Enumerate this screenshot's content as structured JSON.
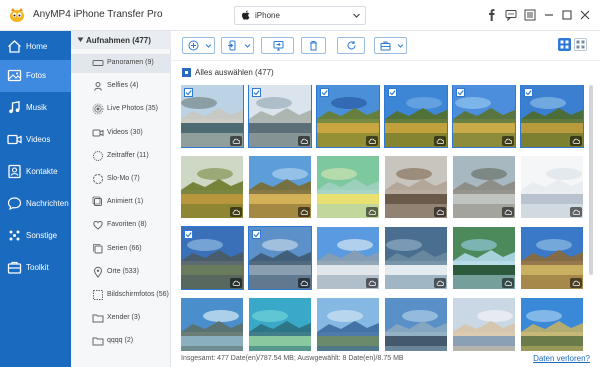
{
  "window": {
    "title": "AnyMP4 iPhone Transfer Pro",
    "device": "iPhone"
  },
  "titlebar_icons": [
    "facebook-icon",
    "feedback-icon",
    "menu-icon",
    "minimize-icon",
    "maximize-icon",
    "close-icon"
  ],
  "sidebar": {
    "items": [
      {
        "label": "Home",
        "icon": "home-icon"
      },
      {
        "label": "Fotos",
        "icon": "photos-icon",
        "active": true
      },
      {
        "label": "Musik",
        "icon": "music-icon"
      },
      {
        "label": "Videos",
        "icon": "video-icon"
      },
      {
        "label": "Kontakte",
        "icon": "contacts-icon"
      },
      {
        "label": "Nachrichten",
        "icon": "messages-icon"
      },
      {
        "label": "Sonstige",
        "icon": "others-icon"
      },
      {
        "label": "Toolkit",
        "icon": "toolkit-icon"
      }
    ]
  },
  "categories": {
    "header": "Aufnahmen (477)",
    "items": [
      {
        "label": "Panoramen (9)",
        "icon": "panorama-icon",
        "active": true
      },
      {
        "label": "Selfies (4)",
        "icon": "selfie-icon"
      },
      {
        "label": "Live Photos (35)",
        "icon": "live-photo-icon"
      },
      {
        "label": "Videos (30)",
        "icon": "video-icon"
      },
      {
        "label": "Zeitraffer (11)",
        "icon": "timelapse-icon"
      },
      {
        "label": "Slo-Mo (7)",
        "icon": "slomo-icon"
      },
      {
        "label": "Animiert (1)",
        "icon": "animated-icon"
      },
      {
        "label": "Favoriten (8)",
        "icon": "favorites-icon"
      },
      {
        "label": "Serien (66)",
        "icon": "burst-icon"
      },
      {
        "label": "Orte (533)",
        "icon": "places-icon"
      },
      {
        "label": "Bildschirmfotos (56)",
        "icon": "screenshot-icon"
      },
      {
        "label": "Xender (3)",
        "icon": "folder-icon"
      },
      {
        "label": "qqqq (2)",
        "icon": "folder-icon"
      }
    ]
  },
  "toolbar": {
    "buttons": [
      "add-button",
      "export-to-device-button",
      "export-to-pc-button",
      "delete-button",
      "refresh-button",
      "toolbox-button"
    ],
    "views": [
      "grid-view-button",
      "list-view-button"
    ]
  },
  "select_all": {
    "label": "Alles auswählen (477)",
    "checked": true
  },
  "photos": {
    "selected": [
      true,
      true,
      true,
      true,
      true,
      true,
      false,
      false,
      false,
      false,
      false,
      false,
      true,
      true,
      false,
      false,
      false,
      false,
      false,
      false,
      false,
      false,
      false,
      false
    ]
  },
  "status": {
    "text": "Insgesamt: 477 Date(en)/787.54 MB; Auswgewählt: 8 Date(en)/8.75 MB",
    "link": "Daten verloren?"
  },
  "colors": {
    "sidebar": "#1a6ac0",
    "sidebar_active": "#3e8ae0",
    "accent": "#2f79d6"
  }
}
